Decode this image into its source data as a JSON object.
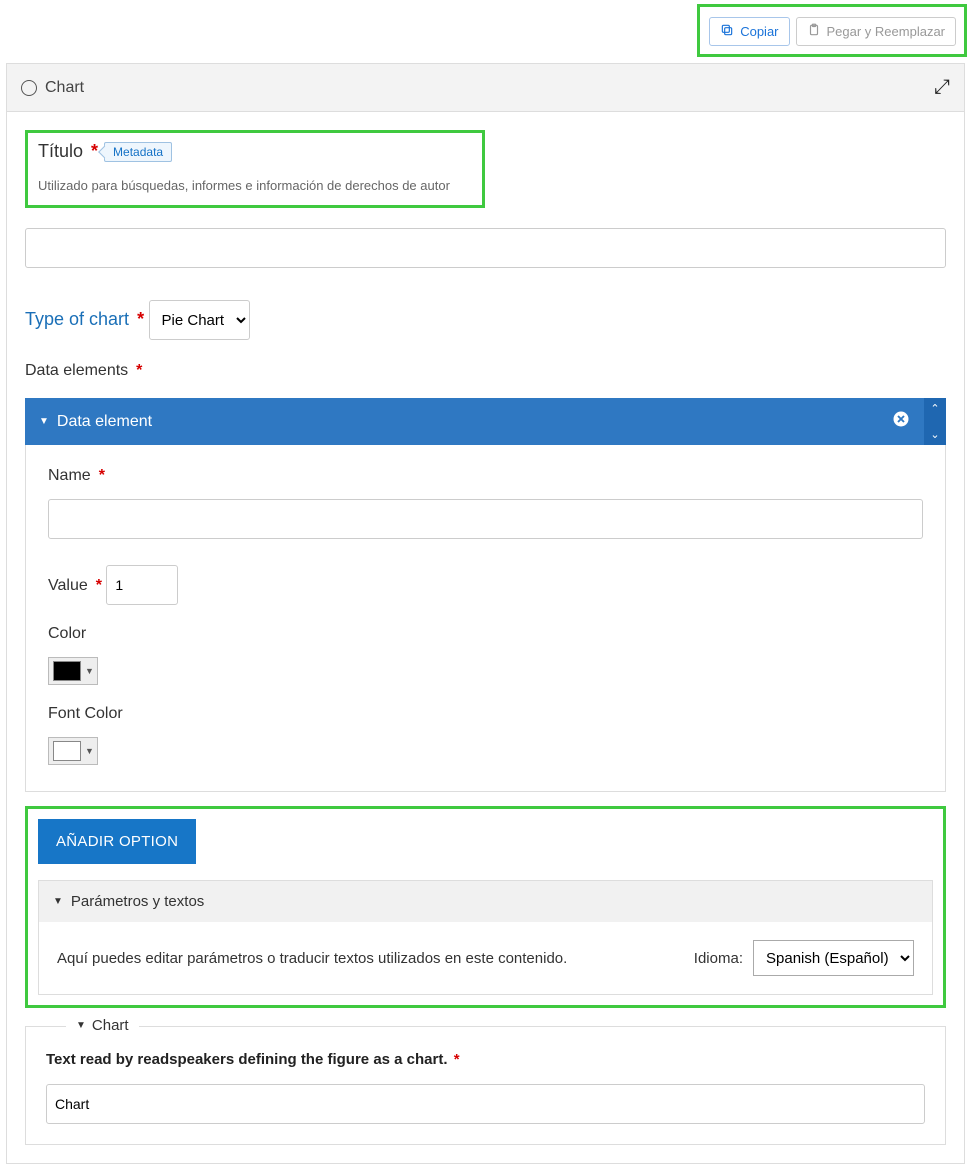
{
  "topbar": {
    "copy": "Copiar",
    "paste": "Pegar y Reemplazar"
  },
  "panel": {
    "title": "Chart"
  },
  "titulo": {
    "label": "Título",
    "meta": "Metadata",
    "desc": "Utilizado para búsquedas, informes e información de derechos de autor",
    "value": ""
  },
  "typeChart": {
    "label": "Type of chart",
    "selected": "Pie Chart"
  },
  "dataElements": {
    "label": "Data elements",
    "item_label": "Data element",
    "name": {
      "label": "Name",
      "value": ""
    },
    "value": {
      "label": "Value",
      "value": "1"
    },
    "color": {
      "label": "Color"
    },
    "fontColor": {
      "label": "Font Color"
    }
  },
  "addOption": "AÑADIR OPTION",
  "params": {
    "label": "Parámetros y textos",
    "desc": "Aquí puedes editar parámetros o traducir textos utilizados en este contenido.",
    "langLabel": "Idioma:",
    "langValue": "Spanish (Español)"
  },
  "innerChart": {
    "legend": "Chart",
    "fieldLabel": "Text read by readspeakers defining the figure as a chart.",
    "value": "Chart"
  }
}
